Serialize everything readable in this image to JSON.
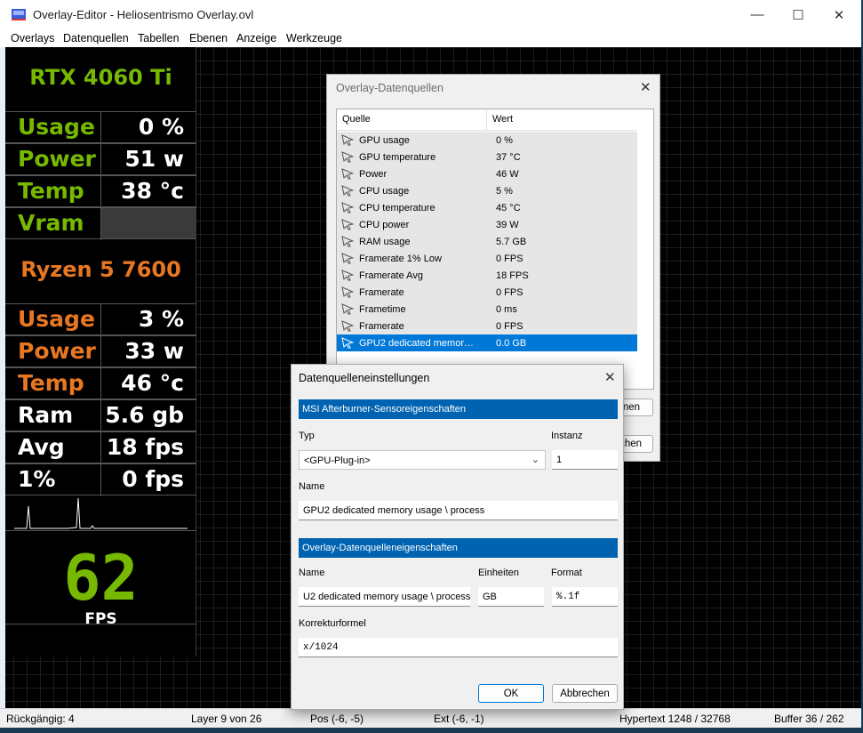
{
  "window": {
    "title": "Overlay-Editor - Heliosentrismo Overlay.ovl",
    "controls": {
      "minimize": "—",
      "maximize": "☐",
      "close": "✕"
    }
  },
  "menu": [
    "Overlays",
    "Datenquellen",
    "Tabellen",
    "Ebenen",
    "Anzeige",
    "Werkzeuge"
  ],
  "overlay": {
    "gpu_title": "RTX 4060 Ti",
    "gpu_rows": [
      {
        "label": "Usage",
        "value": "0 %"
      },
      {
        "label": "Power",
        "value": "51 w"
      },
      {
        "label": "Temp",
        "value": "38 °c"
      },
      {
        "label": "Vram",
        "value": ""
      }
    ],
    "cpu_title": "Ryzen 5 7600",
    "cpu_rows": [
      {
        "label": "Usage",
        "value": "3 %"
      },
      {
        "label": "Power",
        "value": "33 w"
      },
      {
        "label": "Temp",
        "value": "46 °c"
      }
    ],
    "misc_rows": [
      {
        "label": "Ram",
        "value": "5.6 gb"
      },
      {
        "label": "Avg",
        "value": "18 fps"
      },
      {
        "label": "1%",
        "value": "0 fps"
      }
    ],
    "fps_value": "62",
    "fps_unit": "FPS",
    "colors": {
      "gpu": "#76b900",
      "cpu": "#e87722",
      "text": "#ffffff"
    }
  },
  "datasources_dialog": {
    "title": "Overlay-Datenquellen",
    "columns": [
      "Quelle",
      "Wert"
    ],
    "rows": [
      {
        "name": "GPU usage",
        "value": "0 %"
      },
      {
        "name": "GPU temperature",
        "value": "37 °C"
      },
      {
        "name": "Power",
        "value": "46 W"
      },
      {
        "name": "CPU usage",
        "value": "5 %"
      },
      {
        "name": "CPU temperature",
        "value": "45 °C"
      },
      {
        "name": "CPU power",
        "value": "39 W"
      },
      {
        "name": "RAM usage",
        "value": "5.7 GB"
      },
      {
        "name": "Framerate 1% Low",
        "value": "0 FPS"
      },
      {
        "name": "Framerate Avg",
        "value": "18 FPS"
      },
      {
        "name": "Framerate",
        "value": "0 FPS"
      },
      {
        "name": "Frametime",
        "value": "0 ms"
      },
      {
        "name": "Framerate",
        "value": "0 FPS"
      },
      {
        "name": "GPU2 dedicated memor…",
        "value": "0.0 GB"
      }
    ],
    "selected_index": 12,
    "button1": "nen",
    "button2": "chen"
  },
  "settings_dialog": {
    "title": "Datenquelleneinstellungen",
    "section1": "MSI Afterburner-Sensoreigenschaften",
    "type_label": "Typ",
    "type_value": "<GPU-Plug-in>",
    "instance_label": "Instanz",
    "instance_value": "1",
    "name_label": "Name",
    "name_value": "GPU2 dedicated memory usage \\ process",
    "section2": "Overlay-Datenquelleneigenschaften",
    "name2_label": "Name",
    "name2_value": "U2 dedicated memory usage \\ process",
    "units_label": "Einheiten",
    "units_value": "GB",
    "format_label": "Format",
    "format_value": "%.1f",
    "formula_label": "Korrekturformel",
    "formula_value": "x/1024",
    "ok_label": "OK",
    "cancel_label": "Abbrechen"
  },
  "statusbar": {
    "undo": "Rückgängig: 4",
    "layer": "Layer 9 von 26",
    "pos": "Pos (-6, -5)",
    "ext": "Ext (-6, -1)",
    "hypertext": "Hypertext 1248 / 32768",
    "buffer": "Buffer 36 / 262"
  }
}
